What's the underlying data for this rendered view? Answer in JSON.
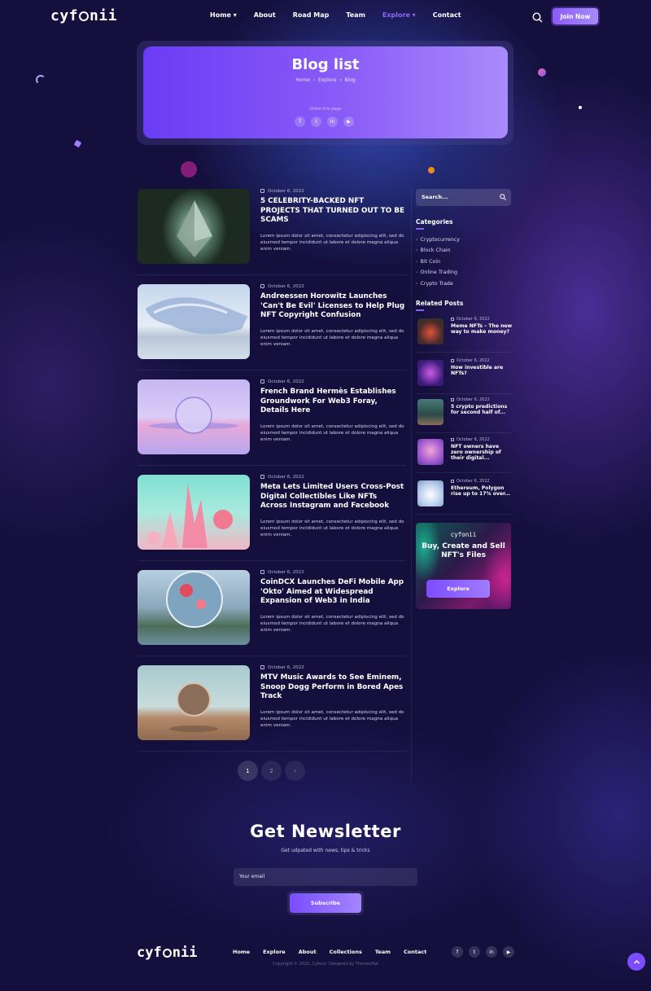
{
  "header": {
    "logo": "cyfonii",
    "nav": [
      "Home",
      "About",
      "Road Map",
      "Team",
      "Explore",
      "Contact"
    ],
    "active_nav": "Explore",
    "join_label": "Join Now"
  },
  "hero": {
    "title": "Blog list",
    "breadcrumb": [
      "Home",
      "Explore",
      "Blog"
    ],
    "share_label": "Share this page",
    "social": [
      "facebook-icon",
      "twitter-icon",
      "linkedin-icon",
      "youtube-icon"
    ]
  },
  "posts": [
    {
      "date": "October 6, 2022",
      "title": "5 CELEBRITY-BACKED NFT PROJECTS THAT TURNED OUT TO BE SCAMS",
      "excerpt": "Lorem ipsum dolor sit amet, consectetur adipiscing elit, sed do eiusmod tempor incididunt ut labore et dolore magna aliqua enim veniam."
    },
    {
      "date": "October 6, 2022",
      "title": "Andreessen Horowitz Launches 'Can't Be Evil' Licenses to Help Plug NFT Copyright Confusion",
      "excerpt": "Lorem ipsum dolor sit amet, consectetur adipiscing elit, sed do eiusmod tempor incididunt ut labore et dolore magna aliqua enim veniam."
    },
    {
      "date": "October 6, 2022",
      "title": "French Brand Hermès Establishes Groundwork For Web3 Foray, Details Here",
      "excerpt": "Lorem ipsum dolor sit amet, consectetur adipiscing elit, sed do eiusmod tempor incididunt ut labore et dolore magna aliqua enim veniam."
    },
    {
      "date": "October 6, 2022",
      "title": "Meta Lets Limited Users Cross-Post Digital Collectibles Like NFTs Across Instagram and Facebook",
      "excerpt": "Lorem ipsum dolor sit amet, consectetur adipiscing elit, sed do eiusmod tempor incididunt ut labore et dolore magna aliqua enim veniam."
    },
    {
      "date": "October 6, 2022",
      "title": "CoinDCX Launches DeFi Mobile App 'Okto' Aimed at Widespread Expansion of Web3 in India",
      "excerpt": "Lorem ipsum dolor sit amet, consectetur adipiscing elit, sed do eiusmod tempor incididunt ut labore et dolore magna aliqua enim veniam."
    },
    {
      "date": "October 6, 2022",
      "title": "MTV Music Awards to See Eminem, Snoop Dogg Perform in Bored Apes Track",
      "excerpt": "Lorem ipsum dolor sit amet, consectetur adipiscing elit, sed do eiusmod tempor incididunt ut labore et dolore magna aliqua enim veniam."
    }
  ],
  "sidebar": {
    "search_placeholder": "Search...",
    "categories_title": "Categories",
    "categories": [
      "Cryptocurrency",
      "Block Chain",
      "Bit Coin",
      "Online Trading",
      "Crypto Trade"
    ],
    "related_title": "Related Posts",
    "related": [
      {
        "date": "October 6, 2022",
        "title": "Meme NFTs – The new way to make money?"
      },
      {
        "date": "October 6, 2022",
        "title": "How investible are NFTs?"
      },
      {
        "date": "October 6, 2022",
        "title": "5 crypto predictions for second half of..."
      },
      {
        "date": "October 6, 2022",
        "title": "NFT owners have zero ownership of their digital..."
      },
      {
        "date": "October 6, 2022",
        "title": "Ethereum, Polygon rise up to 17% over..."
      }
    ],
    "banner": {
      "logo": "cyfonii",
      "title": "Buy, Create and Sell NFT's Files",
      "button": "Explore"
    }
  },
  "pagination": [
    "1",
    "2",
    "›"
  ],
  "newsletter": {
    "title": "Get Newsletter",
    "subtitle": "Get udpated with news, tips & tricks",
    "placeholder": "Your email",
    "button": "Subscribe"
  },
  "footer": {
    "logo": "cyfonii",
    "nav": [
      "Home",
      "Explore",
      "About",
      "Collections",
      "Team",
      "Contact"
    ],
    "social": [
      "facebook-icon",
      "twitter-icon",
      "linkedin-icon",
      "youtube-icon"
    ],
    "copyright": "Copyright © 2022, Cyfonii. Designed by Themesflat"
  },
  "colors": {
    "accent": "#8b5cf6",
    "background": "#140f3c"
  }
}
